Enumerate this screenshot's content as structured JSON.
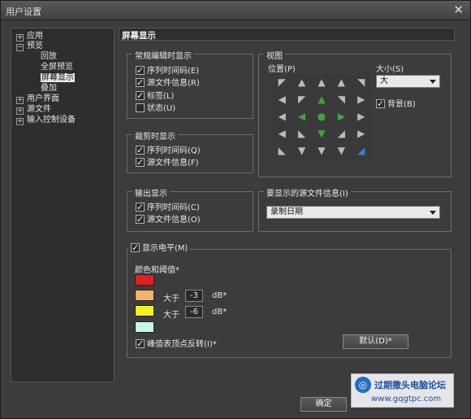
{
  "window": {
    "title": "用户设置",
    "close_glyph": "✕"
  },
  "tree": {
    "items": [
      {
        "label": "应用",
        "expander": "+"
      },
      {
        "label": "预览",
        "expander": "−"
      },
      {
        "label": "回放"
      },
      {
        "label": "全屏预览"
      },
      {
        "label": "屏幕显示",
        "selected": true
      },
      {
        "label": "叠加"
      },
      {
        "label": "用户界面",
        "expander": "+"
      },
      {
        "label": "源文件",
        "expander": "+"
      },
      {
        "label": "输入控制设备",
        "expander": "+"
      }
    ]
  },
  "panel": {
    "header": "屏幕显示",
    "normal_edit": {
      "title": "常规编辑时显示",
      "items": [
        {
          "label": "序列时间码(E)",
          "checked": true
        },
        {
          "label": "源文件信息(R)",
          "checked": true
        },
        {
          "label": "标签(L)",
          "checked": true
        },
        {
          "label": "状态(U)",
          "checked": false
        }
      ]
    },
    "trim": {
      "title": "裁剪时显示",
      "items": [
        {
          "label": "序列时间码(Q)",
          "checked": true
        },
        {
          "label": "源文件信息(F)",
          "checked": true
        }
      ]
    },
    "output": {
      "title": "输出显示",
      "items": [
        {
          "label": "序列时间码(C)",
          "checked": true
        },
        {
          "label": "源文件信息(O)",
          "checked": true
        }
      ]
    },
    "view": {
      "title": "视图",
      "position_label": "位置(P)",
      "size_label": "大小(S)",
      "size_value": "大",
      "background_label": "背景(B)",
      "background_checked": true,
      "grid_icons": [
        "arrow-up-left-icon",
        "arrow-up-icon",
        "arrow-up-icon",
        "arrow-up-icon",
        "arrow-up-right-icon"
      ]
    },
    "source_info": {
      "title": "要显示的源文件信息(I)",
      "value": "录制日期"
    },
    "level": {
      "title": "显示电平(M)",
      "checked": true,
      "color_threshold_label": "颜色和阈值*",
      "colors": [
        "#e02020",
        "#f4b26a",
        "#f2f21e",
        "#c8f4e8"
      ],
      "greater_than": "大于",
      "thresholds": [
        "-3",
        "-6"
      ],
      "unit": "dB*",
      "peak_label": "峰值表顶点反转(I)*",
      "peak_checked": true,
      "default_button": "默认(D)*"
    }
  },
  "footer": {
    "ok_button": "确定"
  },
  "watermark": {
    "line1": "过期撒头电脑论坛",
    "line2": "www.gqgtpc.com"
  }
}
